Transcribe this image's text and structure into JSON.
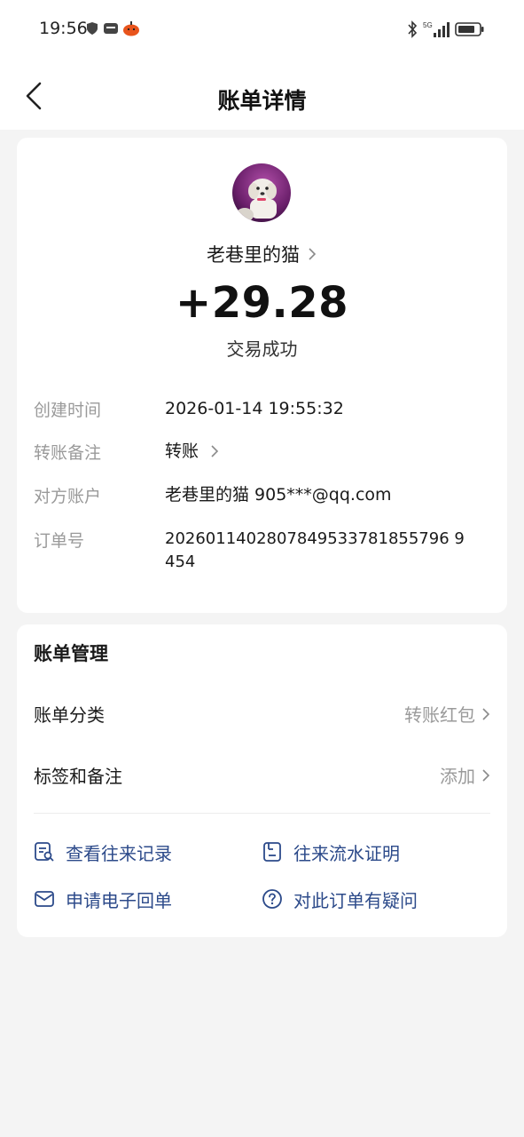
{
  "status_bar": {
    "time": "19:56",
    "left_icons": [
      "shield-icon",
      "message-icon",
      "pumpkin-icon"
    ],
    "right_icons": [
      "bluetooth-icon",
      "signal-5g-icon",
      "battery-icon"
    ],
    "network": "5G"
  },
  "header": {
    "title": "账单详情",
    "back_icon": "chevron-left-icon"
  },
  "summary": {
    "payee_name": "老巷里的猫",
    "amount": "+29.28",
    "status": "交易成功"
  },
  "details": [
    {
      "label": "创建时间",
      "value": "2026-01-14 19:55:32"
    },
    {
      "label": "转账备注",
      "value": "转账"
    },
    {
      "label": "对方账户",
      "value": "老巷里的猫 905***@qq.com"
    },
    {
      "label": "订单号",
      "value": "2026011402807849533781855796 9454"
    }
  ],
  "order_no_lines": [
    "2026011402807849533781855796 9",
    "454"
  ],
  "management": {
    "title": "账单管理",
    "rows": [
      {
        "label": "账单分类",
        "value": "转账红包"
      },
      {
        "label": "标签和备注",
        "value": "添加"
      }
    ],
    "actions": [
      {
        "label": "查看往来记录",
        "icon": "records-search-icon"
      },
      {
        "label": "往来流水证明",
        "icon": "statement-doc-icon"
      },
      {
        "label": "申请电子回单",
        "icon": "envelope-icon"
      },
      {
        "label": "对此订单有疑问",
        "icon": "question-circle-icon"
      }
    ]
  },
  "colors": {
    "accent": "#2c4a8a",
    "background": "#f4f4f4",
    "card": "#ffffff",
    "muted_text": "#9a9a9a"
  }
}
